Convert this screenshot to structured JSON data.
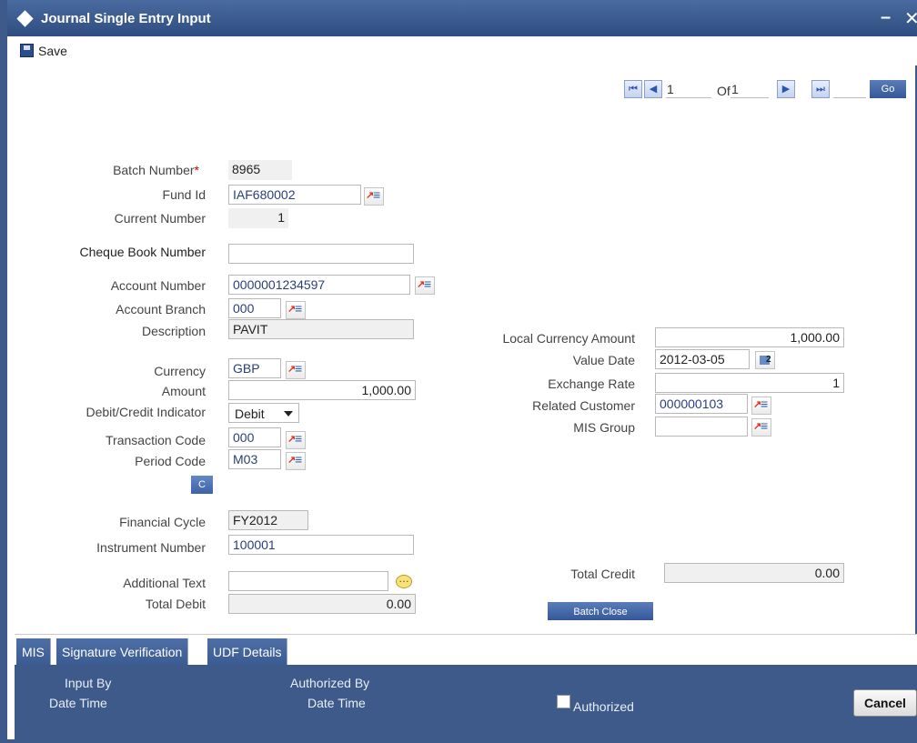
{
  "window": {
    "title": "Journal Single Entry Input",
    "minimize": "–",
    "close": "✕"
  },
  "toolbar": {
    "save_label": "Save"
  },
  "navigator": {
    "current": "1",
    "of_label": "Of",
    "total": "1",
    "go_label": "Go"
  },
  "form": {
    "batch_number": {
      "label": "Batch Number",
      "required": "*",
      "value": "8965"
    },
    "fund_id": {
      "label": "Fund Id",
      "value": "IAF680002"
    },
    "current_number": {
      "label": "Current Number",
      "value": "1"
    },
    "cheque_book_number": {
      "label": "Cheque Book Number",
      "value": ""
    },
    "account_number": {
      "label": "Account Number",
      "value": "0000001234597"
    },
    "account_branch": {
      "label": "Account Branch",
      "value": "000"
    },
    "description": {
      "label": "Description",
      "value": "PAVIT"
    },
    "currency": {
      "label": "Currency",
      "value": "GBP"
    },
    "amount": {
      "label": "Amount",
      "value": "1,000.00"
    },
    "debit_credit": {
      "label": "Debit/Credit Indicator",
      "value": "Debit"
    },
    "transaction_code": {
      "label": "Transaction Code",
      "value": "000"
    },
    "period_code": {
      "label": "Period Code",
      "value": "M03"
    },
    "c_button": "C",
    "financial_cycle": {
      "label": "Financial Cycle",
      "value": "FY2012"
    },
    "instrument_number": {
      "label": "Instrument Number",
      "value": "100001"
    },
    "additional_text": {
      "label": "Additional Text",
      "value": ""
    },
    "total_debit": {
      "label": "Total Debit",
      "value": "0.00"
    },
    "local_currency_amount": {
      "label": "Local Currency Amount",
      "value": "1,000.00"
    },
    "value_date": {
      "label": "Value Date",
      "value": "2012-03-05"
    },
    "exchange_rate": {
      "label": "Exchange Rate",
      "value": "1"
    },
    "related_customer": {
      "label": "Related Customer",
      "value": "000000103"
    },
    "mis_group": {
      "label": "MIS Group",
      "value": ""
    },
    "total_credit": {
      "label": "Total Credit",
      "value": "0.00"
    },
    "batch_close_label": "Batch Close"
  },
  "tabs": [
    {
      "label": "MIS"
    },
    {
      "label": "Signature Verification"
    },
    {
      "label": "UDF Details"
    }
  ],
  "footer": {
    "input_by": "Input By",
    "date_time_1": "Date Time",
    "authorized_by": "Authorized By",
    "date_time_2": "Date Time",
    "authorized_label": "Authorized",
    "cancel_label": "Cancel"
  }
}
